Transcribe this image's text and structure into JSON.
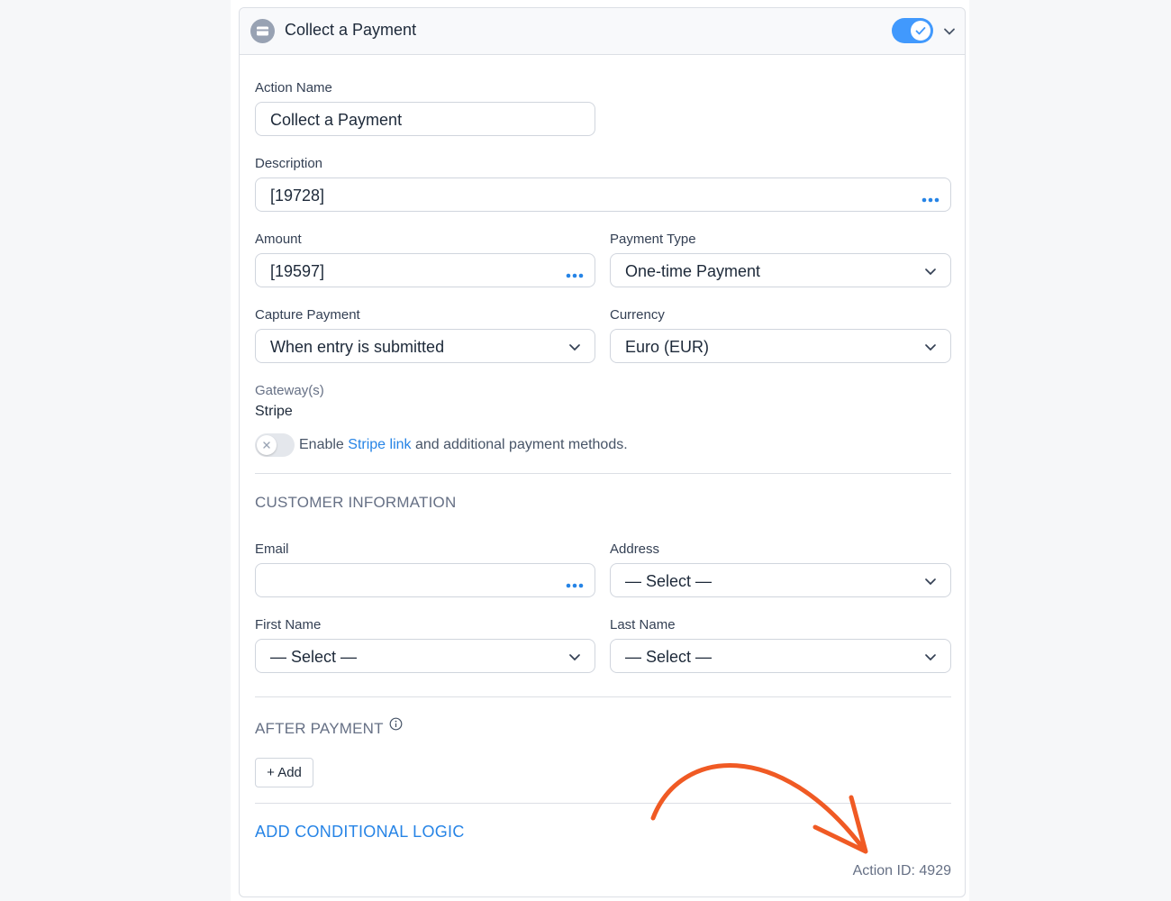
{
  "header": {
    "title": "Collect a Payment",
    "enabled": true
  },
  "form": {
    "action_name": {
      "label": "Action Name",
      "value": "Collect a Payment"
    },
    "description": {
      "label": "Description",
      "value": "[19728]"
    },
    "amount": {
      "label": "Amount",
      "value": "[19597]"
    },
    "payment_type": {
      "label": "Payment Type",
      "value": "One-time Payment"
    },
    "capture_payment": {
      "label": "Capture Payment",
      "value": "When entry is submitted"
    },
    "currency": {
      "label": "Currency",
      "value": "Euro (EUR)"
    },
    "gateways": {
      "label": "Gateway(s)",
      "value": "Stripe",
      "stripe_link_enabled": false,
      "enable_prefix": "Enable ",
      "link_text": "Stripe link",
      "enable_suffix": " and additional payment methods."
    }
  },
  "customer": {
    "section_title": "CUSTOMER INFORMATION",
    "email": {
      "label": "Email",
      "value": ""
    },
    "address": {
      "label": "Address",
      "value": "— Select —"
    },
    "first_name": {
      "label": "First Name",
      "value": "— Select —"
    },
    "last_name": {
      "label": "Last Name",
      "value": "— Select —"
    }
  },
  "after_payment": {
    "section_title": "AFTER PAYMENT",
    "add_label": "+ Add"
  },
  "conditional_logic_label": "ADD CONDITIONAL LOGIC",
  "action_id": "Action ID: 4929",
  "colors": {
    "accent": "#4199fd",
    "link": "#2684e6",
    "annotation_arrow": "#f05a24"
  }
}
